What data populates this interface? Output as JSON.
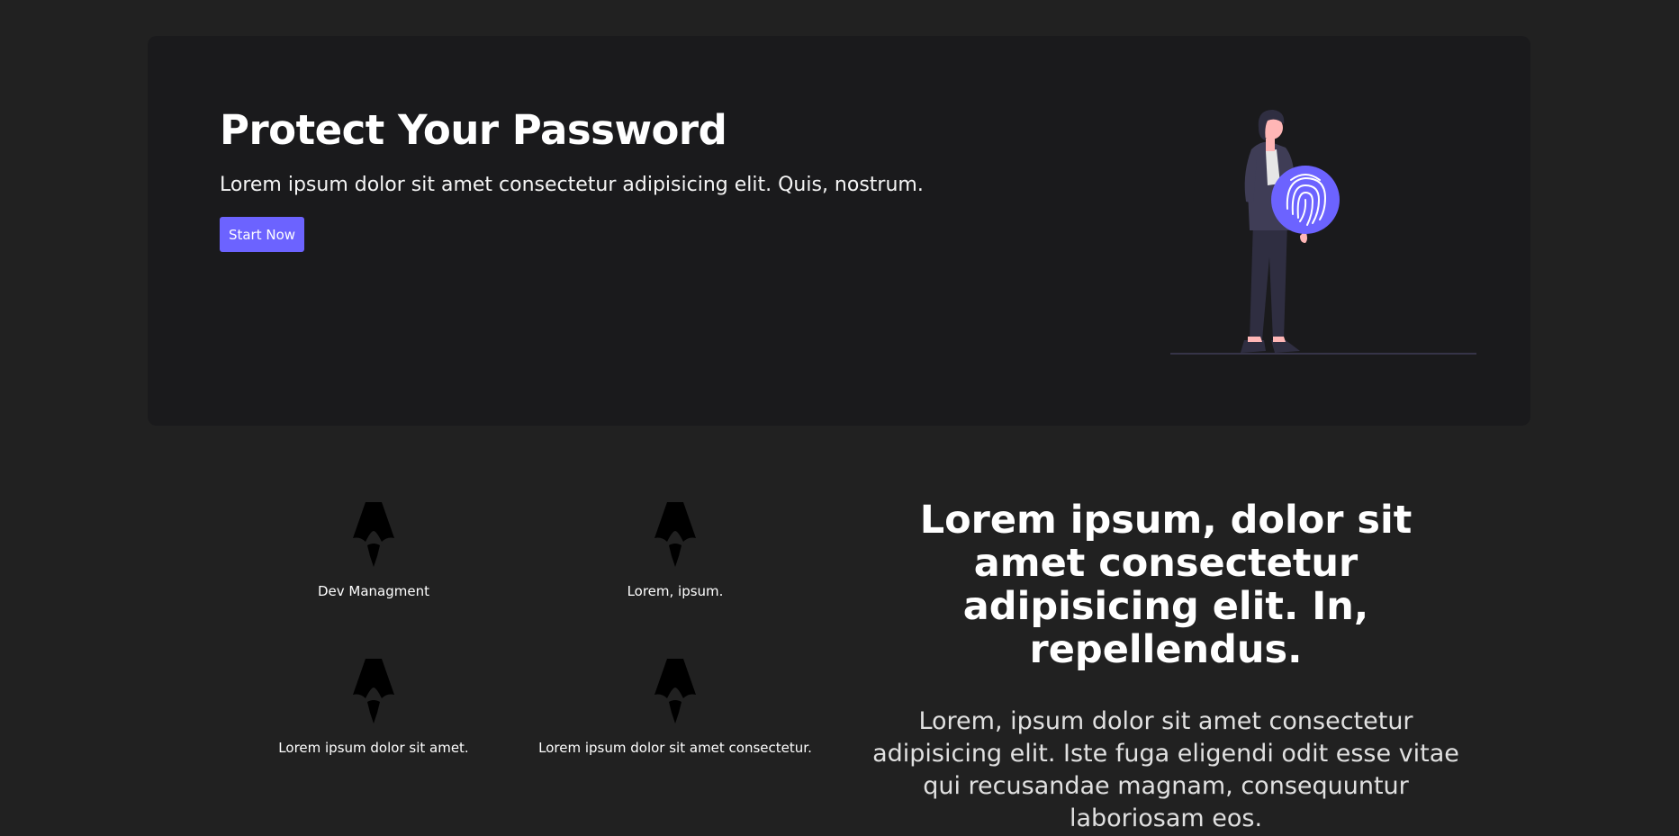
{
  "hero": {
    "title": "Protect Your Password",
    "subtitle": "Lorem ipsum dolor sit amet consectetur adipisicing elit. Quis, nostrum.",
    "button_label": "Start Now",
    "illustration_icon": "person-fingerprint-illustration"
  },
  "features": [
    {
      "icon": "rocket-icon",
      "label": "Dev Managment"
    },
    {
      "icon": "rocket-icon",
      "label": "Lorem, ipsum."
    },
    {
      "icon": "rocket-icon",
      "label": "Lorem ipsum dolor sit amet."
    },
    {
      "icon": "rocket-icon",
      "label": "Lorem ipsum dolor sit amet consectetur."
    }
  ],
  "info": {
    "heading": "Lorem ipsum, dolor sit amet consectetur adipisicing elit. In, repellendus.",
    "text": "Lorem, ipsum dolor sit amet consectetur adipisicing elit. Iste fuga eligendi odit esse vitae qui recusandae magnam, consequuntur laboriosam eos."
  },
  "colors": {
    "page_background": "#212121",
    "hero_background": "#1a1a1c",
    "accent": "#6c63ff",
    "text": "#ffffff"
  }
}
